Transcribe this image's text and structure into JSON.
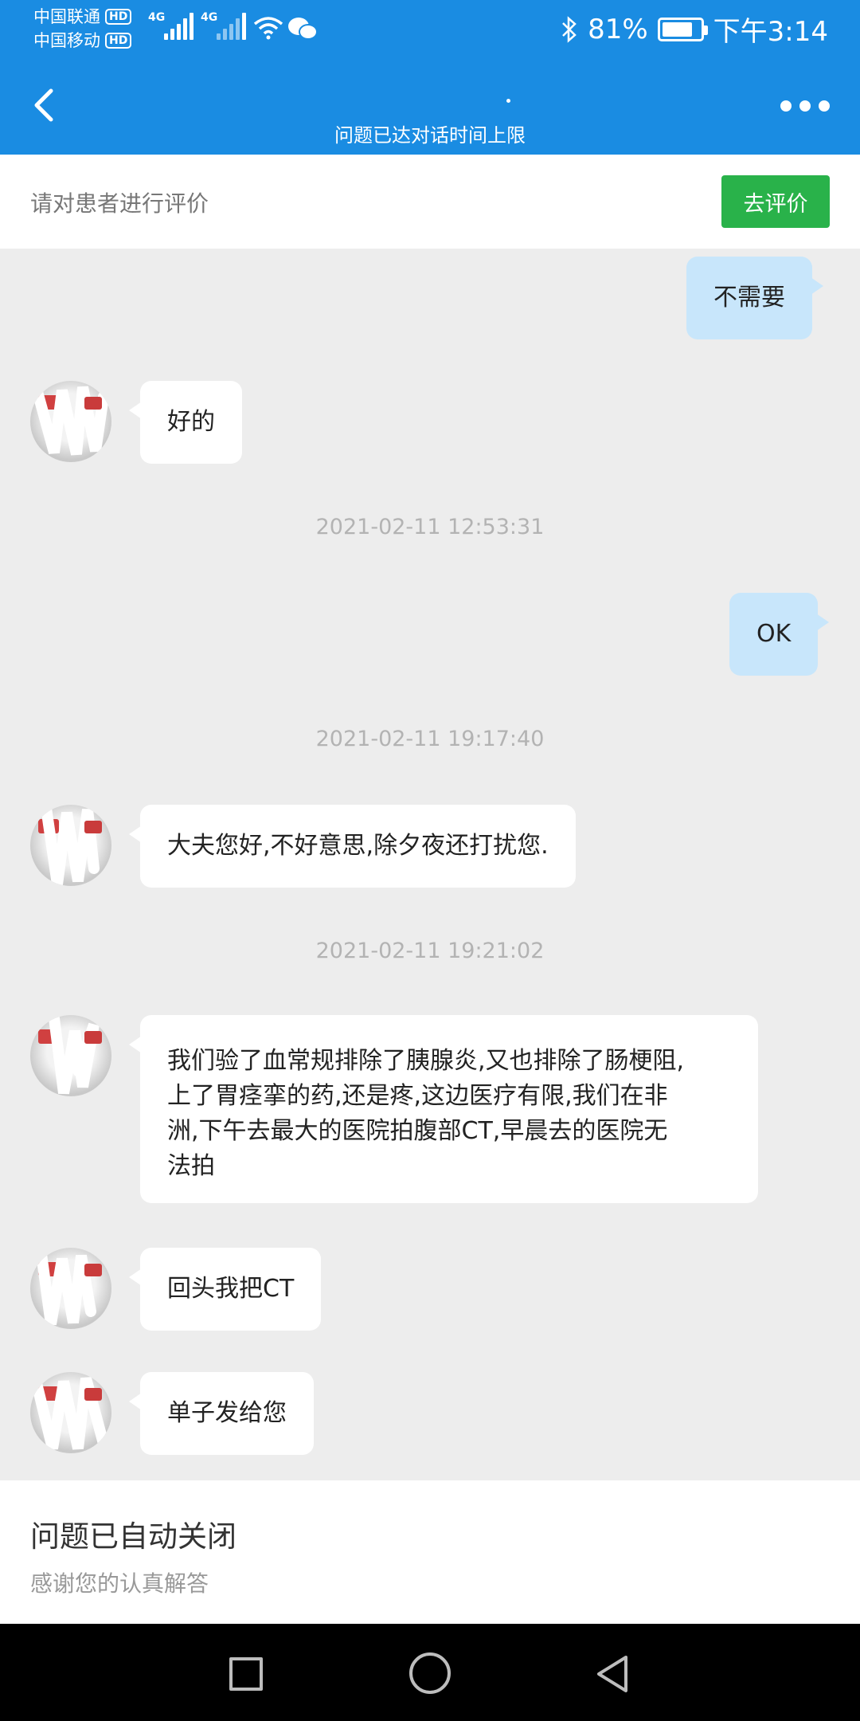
{
  "status_bar": {
    "carrier_1": "中国联通",
    "carrier_2": "中国移动",
    "hd_label": "HD",
    "net_label": "4G",
    "battery_text": "81%",
    "battery_level": 0.81,
    "time": "下午3:14"
  },
  "nav": {
    "subtitle": "问题已达对话时间上限"
  },
  "review_bar": {
    "prompt": "请对患者进行评价",
    "button_label": "去评价",
    "button_color": "#29b24a"
  },
  "messages": {
    "m1": "不需要",
    "m2": "好的",
    "t1": "2021-02-11 12:53:31",
    "m3": "OK",
    "t2": "2021-02-11 19:17:40",
    "m4": "大夫您好,不好意思,除夕夜还打扰您.",
    "t3": "2021-02-11 19:21:02",
    "m5_line1": "我们验了血常规排除了胰腺炎,又也排除了肠梗阻,",
    "m5_line2": "上了胃痉挛的药,还是疼,这边医疗有限,我们在非",
    "m5_line3": "洲,下午去最大的医院拍腹部CT,早晨去的医院无",
    "m5_line4": "法拍",
    "m6": "回头我把CT",
    "m7": "单子发给您"
  },
  "closed_panel": {
    "title": "问题已自动关闭",
    "subtitle": "感谢您的认真解答"
  },
  "colors": {
    "header_blue": "#1a8ce2",
    "bubble_right": "#c8e6fb",
    "bubble_left": "#ffffff",
    "chat_bg": "#ededed"
  }
}
